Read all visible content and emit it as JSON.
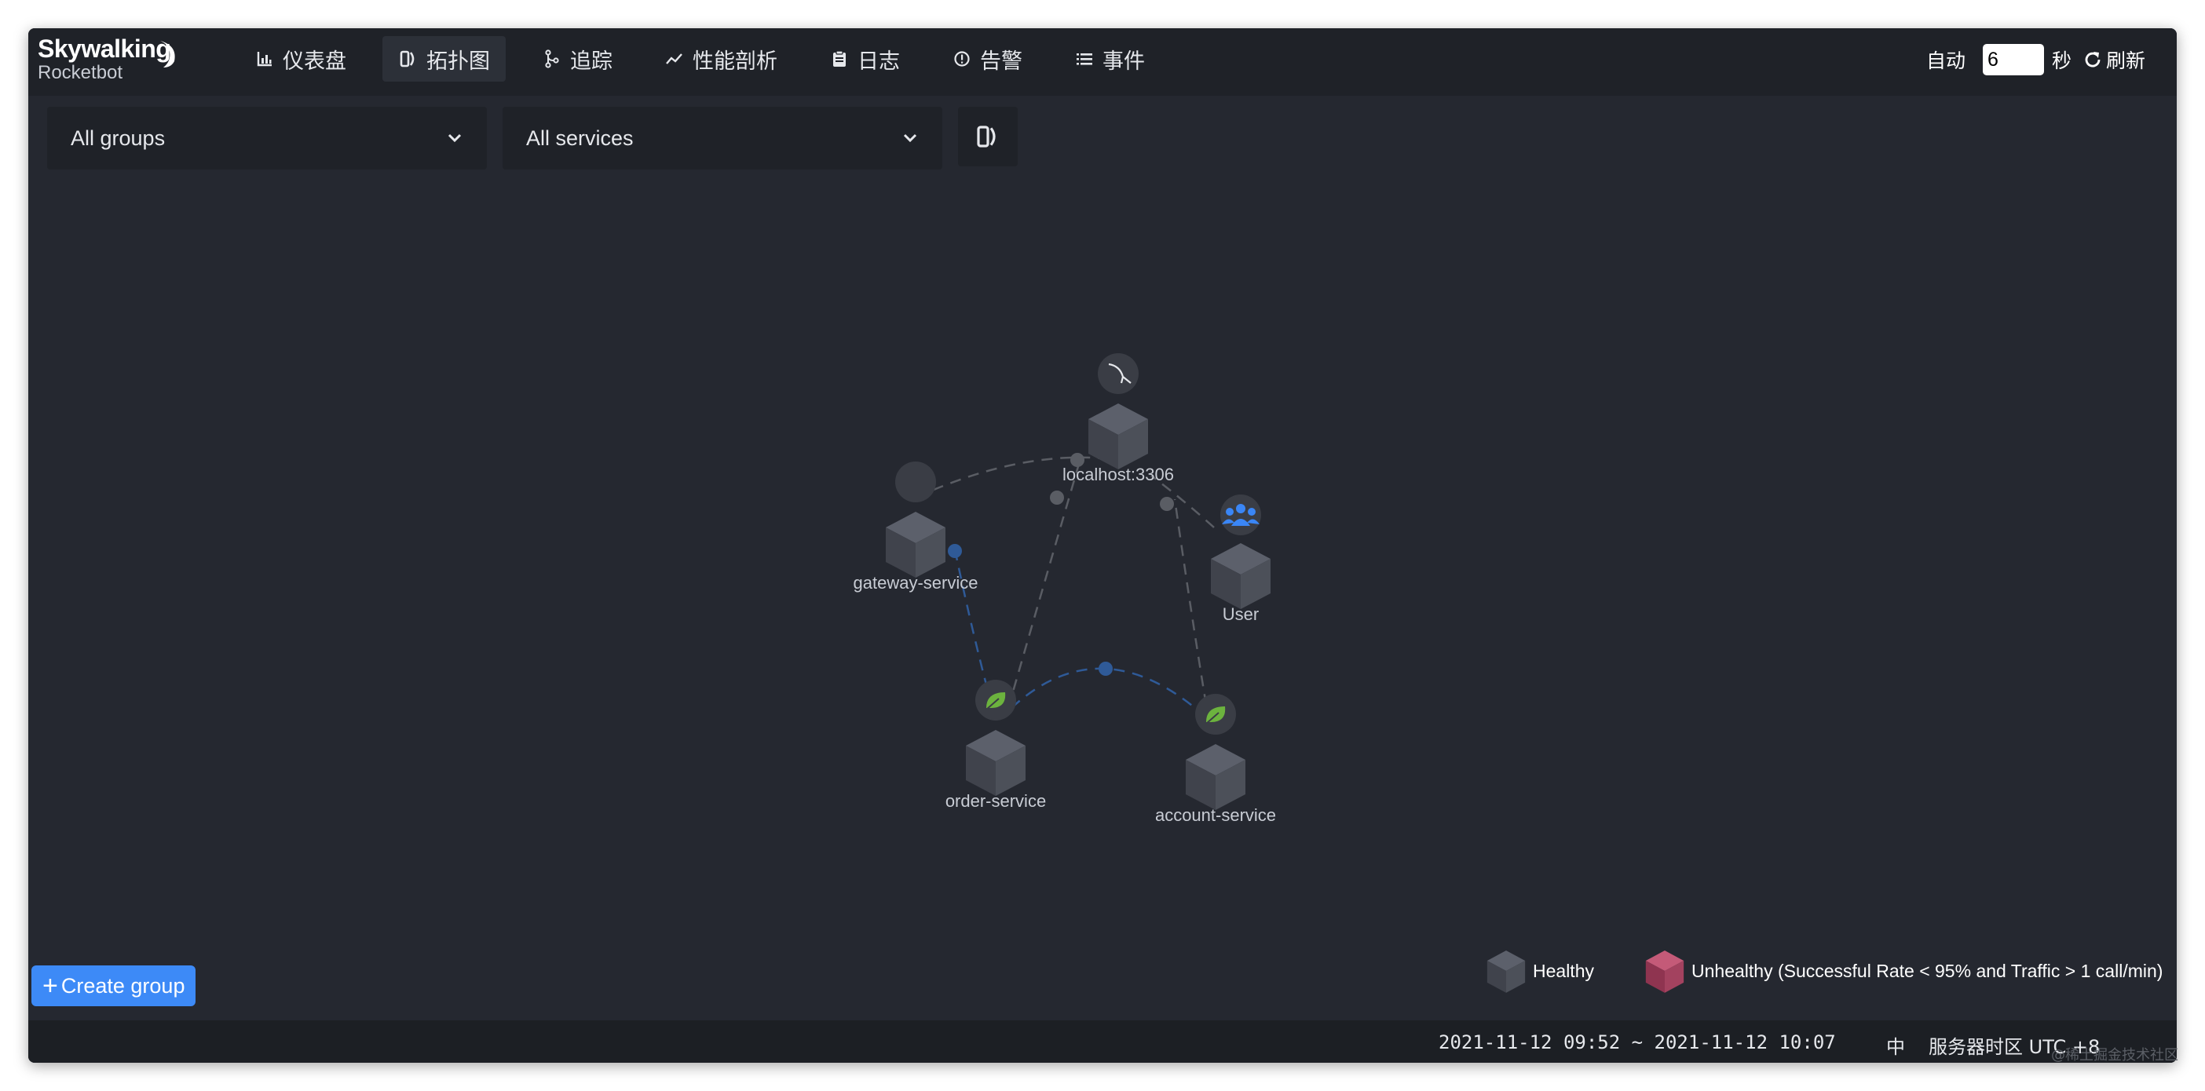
{
  "app": {
    "logo_line1": "Skywalking",
    "logo_line2": "Rocketbot"
  },
  "nav": {
    "items": [
      {
        "label": "仪表盘",
        "icon": "dashboard-chart-icon",
        "active": false
      },
      {
        "label": "拓扑图",
        "icon": "topology-icon",
        "active": true
      },
      {
        "label": "追踪",
        "icon": "trace-branch-icon",
        "active": false
      },
      {
        "label": "性能剖析",
        "icon": "profile-trend-icon",
        "active": false
      },
      {
        "label": "日志",
        "icon": "log-clipboard-icon",
        "active": false
      },
      {
        "label": "告警",
        "icon": "alarm-icon",
        "active": false
      },
      {
        "label": "事件",
        "icon": "event-list-icon",
        "active": false
      }
    ]
  },
  "refresh": {
    "auto_label": "自动",
    "interval_value": "6",
    "unit_label": "秒",
    "refresh_label": "刷新"
  },
  "filters": {
    "groups_value": "All groups",
    "services_value": "All services"
  },
  "topology": {
    "nodes": [
      {
        "id": "mysql",
        "label": "localhost:3306",
        "type": "mysql"
      },
      {
        "id": "gateway",
        "label": "gateway-service",
        "type": "unknown"
      },
      {
        "id": "user",
        "label": "User",
        "type": "user"
      },
      {
        "id": "order",
        "label": "order-service",
        "type": "spring"
      },
      {
        "id": "account",
        "label": "account-service",
        "type": "spring"
      }
    ],
    "edges": [
      {
        "from": "gateway",
        "to": "mysql"
      },
      {
        "from": "gateway",
        "to": "order"
      },
      {
        "from": "order",
        "to": "mysql"
      },
      {
        "from": "account",
        "to": "mysql"
      },
      {
        "from": "user",
        "to": "mysql"
      },
      {
        "from": "order",
        "to": "account"
      }
    ]
  },
  "actions": {
    "create_group_label": "Create group"
  },
  "legend": {
    "healthy_label": "Healthy",
    "unhealthy_label": "Unhealthy (Successful Rate < 95% and Traffic > 1 call/min)",
    "healthy_color": "#4a4e5a",
    "unhealthy_color": "#a3425f"
  },
  "footer": {
    "time_range": "2021-11-12 09:52 ~ 2021-11-12 10:07",
    "language": "中",
    "timezone": "服务器时区 UTC +8"
  },
  "watermark": "@稀土掘金技术社区"
}
